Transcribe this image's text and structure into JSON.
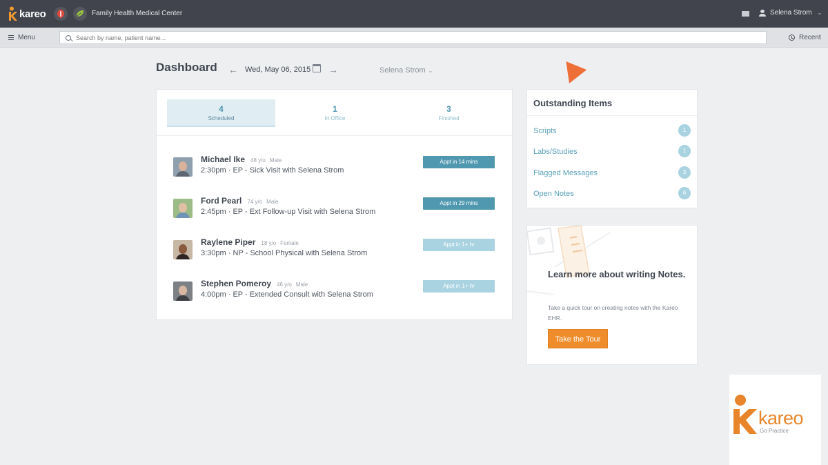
{
  "topbar": {
    "brand": "kareo",
    "practice_name": "Family Health Medical Center",
    "user_name": "Selena Strom"
  },
  "subbar": {
    "menu_label": "Menu",
    "search_placeholder": "Search by name, patient name...",
    "recent_label": "Recent"
  },
  "dashboard": {
    "title": "Dashboard",
    "date": "Wed, May 06, 2015",
    "provider": "Selena Strom"
  },
  "tabs": [
    {
      "count": "4",
      "label": "Scheduled"
    },
    {
      "count": "1",
      "label": "In Office"
    },
    {
      "count": "3",
      "label": "Finished"
    }
  ],
  "appointments": [
    {
      "name": "Michael Ike",
      "age": "48 y/o",
      "sex": "Male",
      "detail": "2:30pm · EP - Sick Visit with Selena Strom",
      "status": "Appt in 14 mins"
    },
    {
      "name": "Ford Pearl",
      "age": "74 y/o",
      "sex": "Male",
      "detail": "2:45pm · EP - Ext Follow-up Visit with Selena Strom",
      "status": "Appt in 29 mins"
    },
    {
      "name": "Raylene Piper",
      "age": "18 y/o",
      "sex": "Female",
      "detail": "3:30pm · NP - School Physical with Selena Strom",
      "status": "Appt in 1+ hr"
    },
    {
      "name": "Stephen Pomeroy",
      "age": "46 y/o",
      "sex": "Male",
      "detail": "4:00pm · EP - Extended Consult with Selena Strom",
      "status": "Appt in 1+ hr"
    }
  ],
  "outstanding": {
    "title": "Outstanding Items",
    "items": [
      {
        "label": "Scripts",
        "count": "1"
      },
      {
        "label": "Labs/Studies",
        "count": "1"
      },
      {
        "label": "Flagged Messages",
        "count": "3"
      },
      {
        "label": "Open Notes",
        "count": "6"
      }
    ]
  },
  "learn": {
    "title": "Learn more about writing Notes.",
    "description": "Take a quick tour on creating notes with the Kareo EHR.",
    "button_label": "Take the Tour"
  },
  "watermark": {
    "brand": "kareo",
    "tagline": "Go Practice"
  },
  "colors": {
    "accent": "#4f98b0",
    "orange": "#ef8c2c",
    "topbar": "#41444d"
  }
}
